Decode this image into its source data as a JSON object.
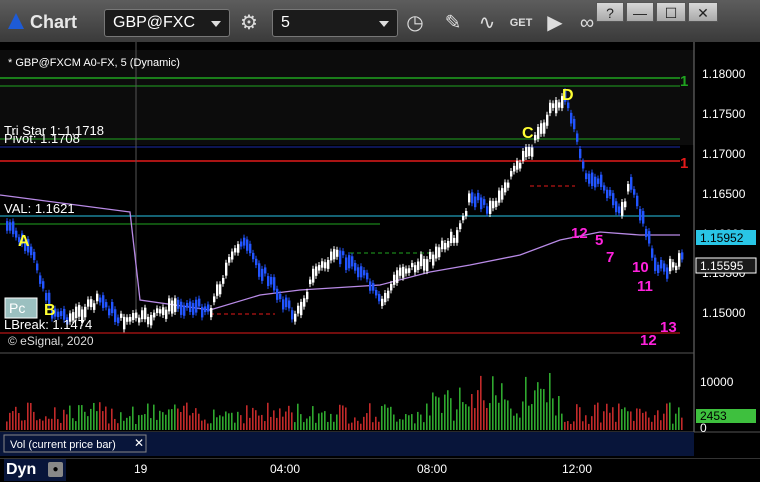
{
  "window": {
    "title": "Chart"
  },
  "toolbar": {
    "symbol": "GBP@FXC",
    "interval": "5"
  },
  "window_controls": {
    "help": "?",
    "minimize": "—",
    "maximize": "☐",
    "close": "✕"
  },
  "chart_header": {
    "label": "* GBP@FXCM A0-FX, 5 (Dynamic)"
  },
  "overlays": {
    "tri_star": "Tri Star 1: 1.1718",
    "pivot": "Pivot: 1.1708",
    "val": "VAL: 1.1621",
    "lbreak": "LBreak: 1.1474",
    "copyright": "© eSignal, 2020",
    "pc_label": "Pc",
    "line1_label": "1"
  },
  "price_axis": {
    "ticks": [
      "1.18000",
      "1.17500",
      "1.17000",
      "1.16500",
      "1.16000",
      "1.15500",
      "1.15000"
    ],
    "current_top": "1.15952",
    "current_bottom": "1.15595"
  },
  "volume_axis": {
    "ticks": [
      "10000",
      "0"
    ],
    "current": "2453"
  },
  "time_axis": {
    "ticks": [
      "19",
      "04:00",
      "08:00",
      "12:00"
    ]
  },
  "volume_panel": {
    "label": "Vol (current price bar)"
  },
  "status": {
    "label": "Dyn"
  },
  "markers": {
    "A": "A",
    "B": "B",
    "C": "C",
    "D": "D",
    "n12": "12",
    "n5": "5",
    "n7": "7",
    "n10": "10",
    "n11": "11",
    "n12b": "12",
    "n13": "13",
    "n1r": "1"
  },
  "colors": {
    "bull": "#ffffff",
    "bear": "#2255ff",
    "pivot_line": "#e31a1a",
    "val_line": "#29c5e6",
    "green_line": "#1fa31f",
    "blue_line": "#1a2aa8",
    "vwap": "#b88ae6",
    "vol_up": "#2fa82f",
    "vol_down": "#c22a2a",
    "marker_yellow": "#ffff33",
    "marker_magenta": "#ff22dd"
  }
}
